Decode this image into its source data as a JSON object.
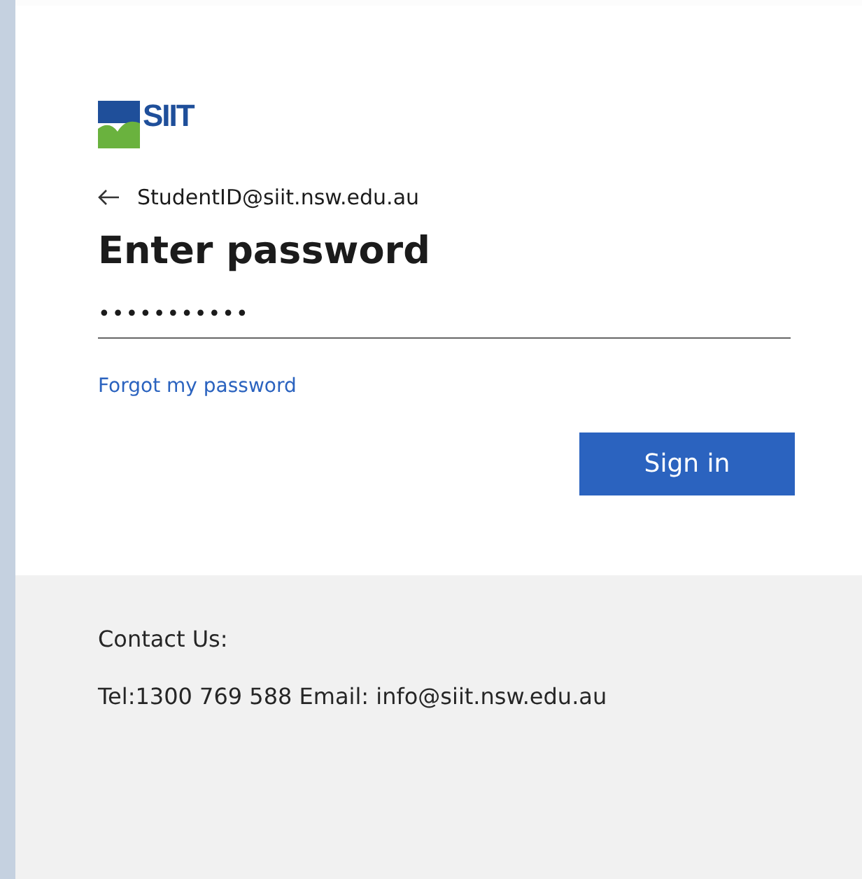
{
  "logo": {
    "text": "SIIT"
  },
  "identity": {
    "email": "StudentID@siit.nsw.edu.au"
  },
  "title": "Enter password",
  "password_field": {
    "value": "•••••••••••"
  },
  "forgot_link": "Forgot my password",
  "sign_in_button": "Sign in",
  "footer": {
    "heading": "Contact Us:",
    "contact": "Tel:1300 769 588 Email: info@siit.nsw.edu.au"
  }
}
